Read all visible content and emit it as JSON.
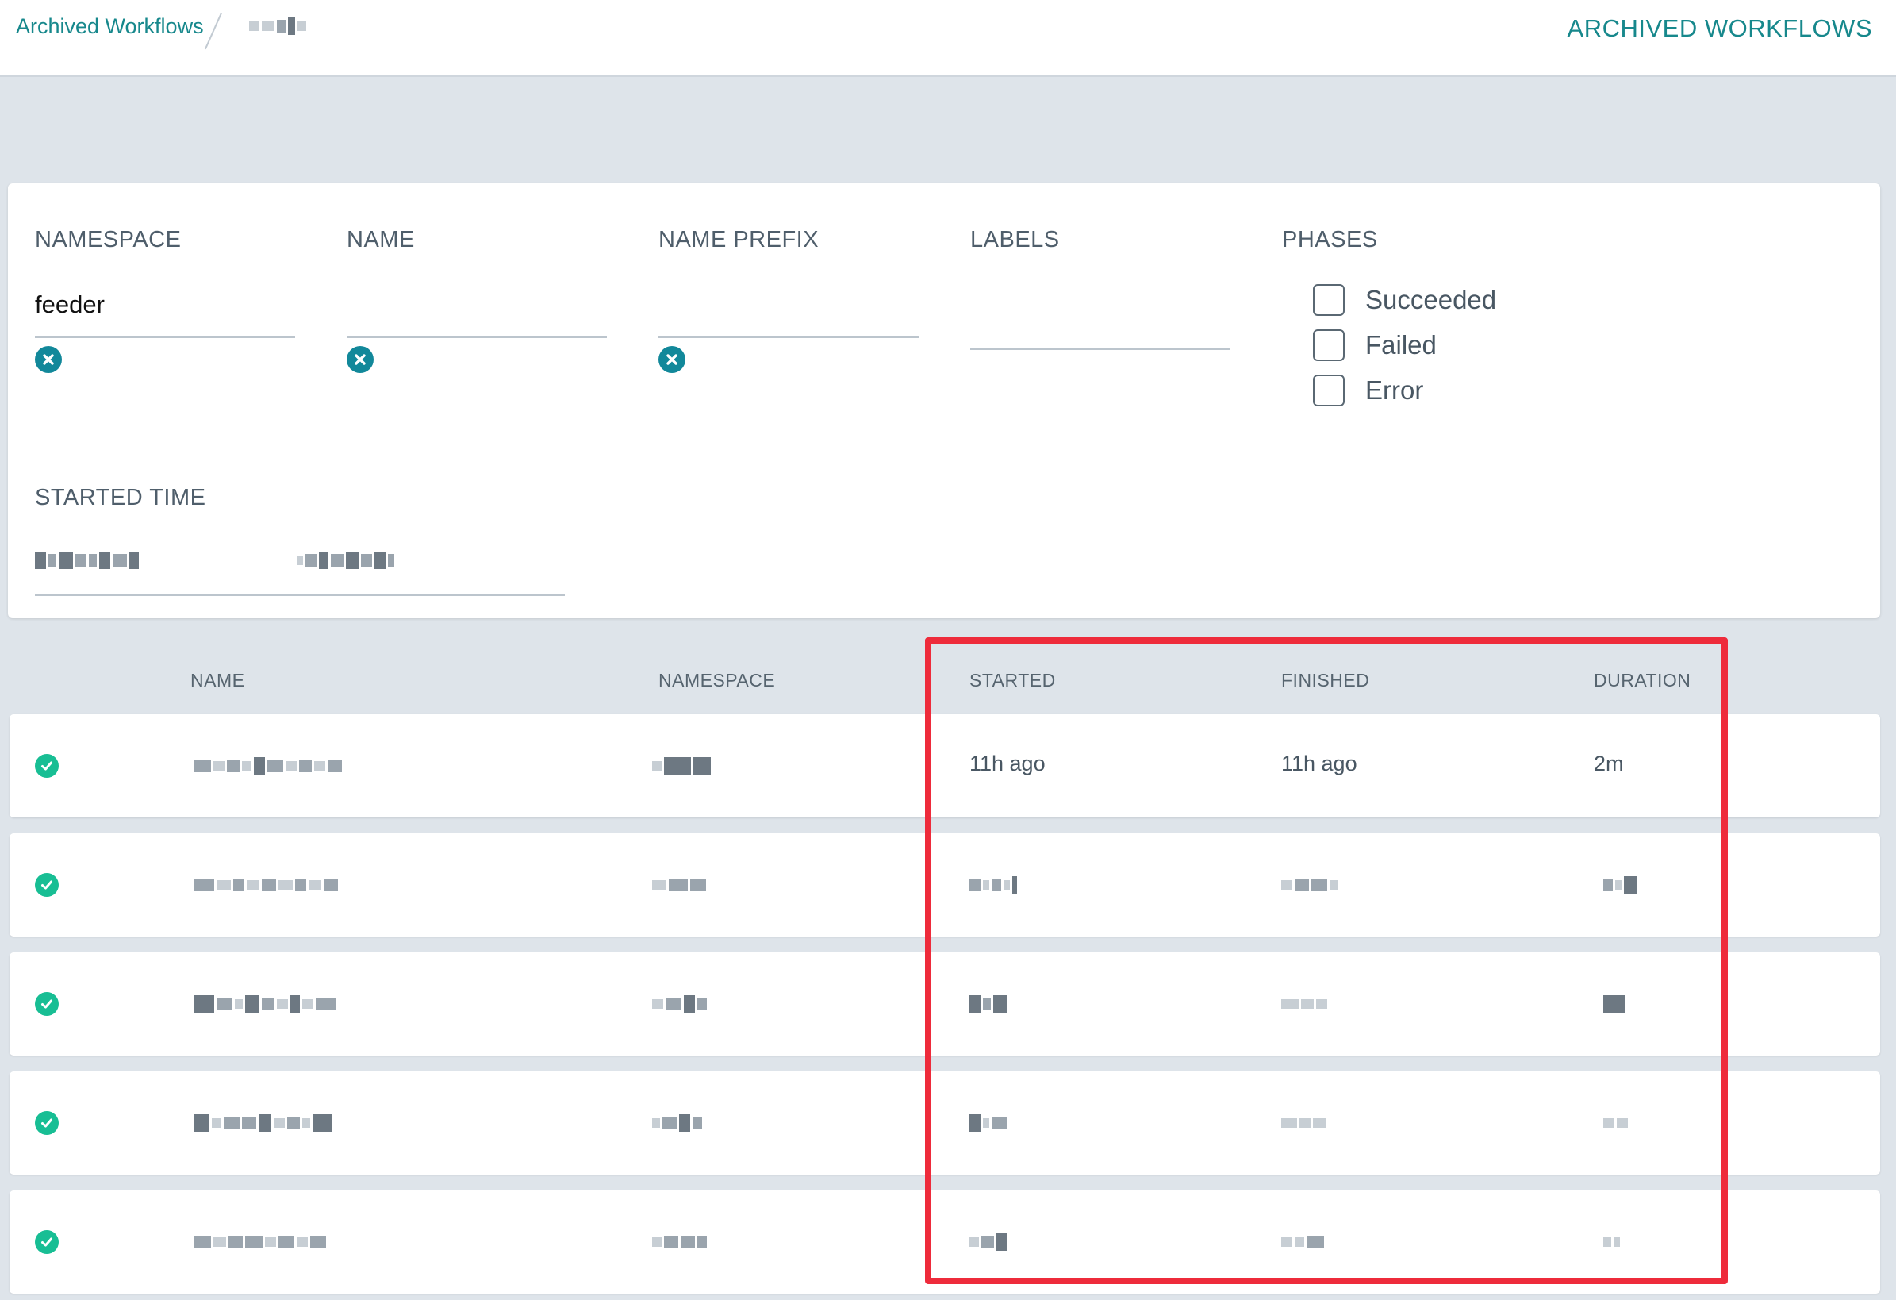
{
  "breadcrumb": {
    "link_label": "Archived Workflows",
    "current_label": "(redacted)"
  },
  "header": {
    "title": "ARCHIVED WORKFLOWS"
  },
  "filters": {
    "namespace": {
      "label": "NAMESPACE",
      "value": "feeder"
    },
    "name": {
      "label": "NAME",
      "value": ""
    },
    "name_prefix": {
      "label": "NAME PREFIX",
      "value": ""
    },
    "labels": {
      "label": "LABELS",
      "value": ""
    },
    "phases": {
      "label": "PHASES",
      "options": [
        "Succeeded",
        "Failed",
        "Error"
      ]
    },
    "started_time": {
      "label": "STARTED TIME",
      "from": "(redacted)",
      "to": "(redacted)"
    }
  },
  "table": {
    "columns": [
      "NAME",
      "NAMESPACE",
      "STARTED",
      "FINISHED",
      "DURATION"
    ],
    "rows": [
      {
        "status": "succeeded",
        "name": "(redacted)",
        "namespace": "(redacted)",
        "started": "11h ago",
        "finished": "11h ago",
        "duration": "2m"
      },
      {
        "status": "succeeded",
        "name": "(redacted)",
        "namespace": "(redacted)",
        "started": "(redacted)",
        "finished": "(redacted)",
        "duration": "(redacted)"
      },
      {
        "status": "succeeded",
        "name": "(redacted)",
        "namespace": "(redacted)",
        "started": "(redacted)",
        "finished": "(redacted)",
        "duration": "(redacted)"
      },
      {
        "status": "succeeded",
        "name": "(redacted)",
        "namespace": "(redacted)",
        "started": "(redacted)",
        "finished": "(redacted)",
        "duration": "(redacted)"
      },
      {
        "status": "succeeded",
        "name": "(redacted)",
        "namespace": "(redacted)",
        "started": "(redacted)",
        "finished": "(redacted)",
        "duration": "(redacted)"
      }
    ]
  },
  "colors": {
    "accent": "#17888c",
    "success": "#18be94",
    "highlight": "#ee2b3b",
    "background": "#dee4ea"
  },
  "icons": {
    "clear": "times-circle-icon",
    "status": "check-circle-icon"
  }
}
